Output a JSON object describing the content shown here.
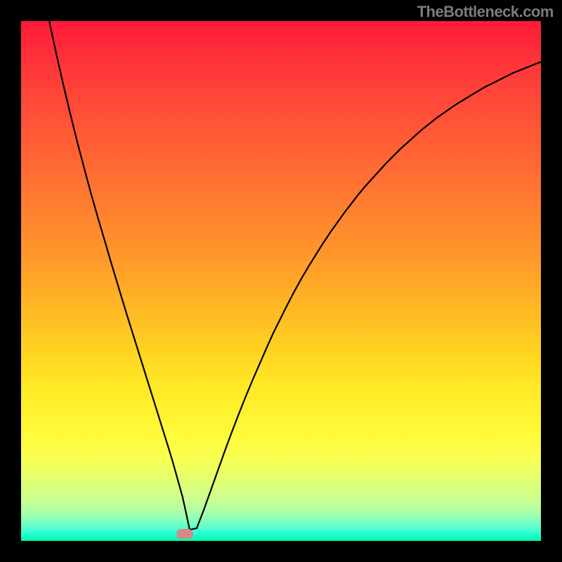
{
  "attribution": "TheBottleneck.com",
  "chart_data": {
    "type": "line",
    "title": "",
    "xlabel": "",
    "ylabel": "",
    "xlim": [
      0,
      1
    ],
    "ylim": [
      0,
      1
    ],
    "background": "gradient-rainbow-red-to-green-vertical",
    "marker": {
      "x": 0.315,
      "y": 0.987,
      "shape": "pill",
      "color": "#d48b88"
    },
    "x": [
      0.0542,
      0.0676,
      0.0811,
      0.0946,
      0.1081,
      0.1216,
      0.1351,
      0.1486,
      0.1622,
      0.1757,
      0.1892,
      0.2027,
      0.2162,
      0.2297,
      0.2432,
      0.2568,
      0.2703,
      0.2838,
      0.2919,
      0.2973,
      0.3108,
      0.3162,
      0.3243,
      0.3378,
      0.3514,
      0.3649,
      0.3784,
      0.3919,
      0.4054,
      0.4189,
      0.4324,
      0.4459,
      0.4595,
      0.473,
      0.4865,
      0.5,
      0.5135,
      0.527,
      0.5405,
      0.5541,
      0.5676,
      0.5811,
      0.5946,
      0.6081,
      0.6216,
      0.6351,
      0.6486,
      0.6622,
      0.6757,
      0.6892,
      0.7027,
      0.7162,
      0.7297,
      0.7432,
      0.7568,
      0.7703,
      0.7838,
      0.7973,
      0.8108,
      0.8243,
      0.8378,
      0.8514,
      0.8649,
      0.8784,
      0.8919,
      0.9054,
      0.9189,
      0.9324,
      0.9459,
      0.9595,
      0.973,
      0.9865,
      1.0
    ],
    "y": [
      0.0,
      0.0622,
      0.1216,
      0.1784,
      0.2324,
      0.2838,
      0.3338,
      0.3811,
      0.427,
      0.473,
      0.5176,
      0.5622,
      0.6054,
      0.6486,
      0.6919,
      0.7351,
      0.7784,
      0.8216,
      0.8486,
      0.8676,
      0.9162,
      0.9405,
      0.9784,
      0.9757,
      0.9405,
      0.9027,
      0.8649,
      0.827,
      0.7905,
      0.7554,
      0.7216,
      0.6892,
      0.6581,
      0.627,
      0.5973,
      0.5703,
      0.5432,
      0.5176,
      0.4932,
      0.4703,
      0.4486,
      0.427,
      0.4068,
      0.3878,
      0.3689,
      0.3514,
      0.3338,
      0.3176,
      0.3027,
      0.2878,
      0.273,
      0.2595,
      0.2459,
      0.2338,
      0.2216,
      0.2095,
      0.1986,
      0.1878,
      0.1784,
      0.1689,
      0.1595,
      0.1514,
      0.1432,
      0.1351,
      0.127,
      0.1203,
      0.1135,
      0.1068,
      0.1,
      0.0946,
      0.0892,
      0.0838,
      0.0784
    ]
  }
}
